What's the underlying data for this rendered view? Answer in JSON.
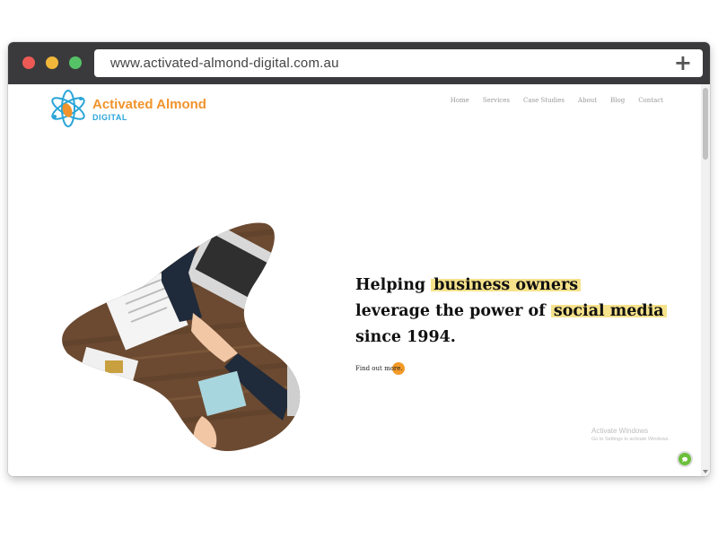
{
  "browser": {
    "url": "www.activated-almond-digital.com.au",
    "new_tab_icon": "+"
  },
  "logo": {
    "name": "Activated Almond",
    "sub": "DIGITAL"
  },
  "nav": {
    "items": [
      "Home",
      "Services",
      "Case Studies",
      "About",
      "Blog",
      "Contact"
    ]
  },
  "hero": {
    "line1_a": "Helping ",
    "line1_hl": "business owners",
    "line2_a": "leverage the power of ",
    "line2_hl": "social media",
    "line3": "since 1994.",
    "cta": "Find out more."
  },
  "watermark": {
    "title": "Activate Windows",
    "sub": "Go to Settings to activate Windows."
  },
  "colors": {
    "accent_orange": "#f39a28",
    "logo_blue": "#2aa5d8",
    "highlight": "#f6e28b"
  }
}
